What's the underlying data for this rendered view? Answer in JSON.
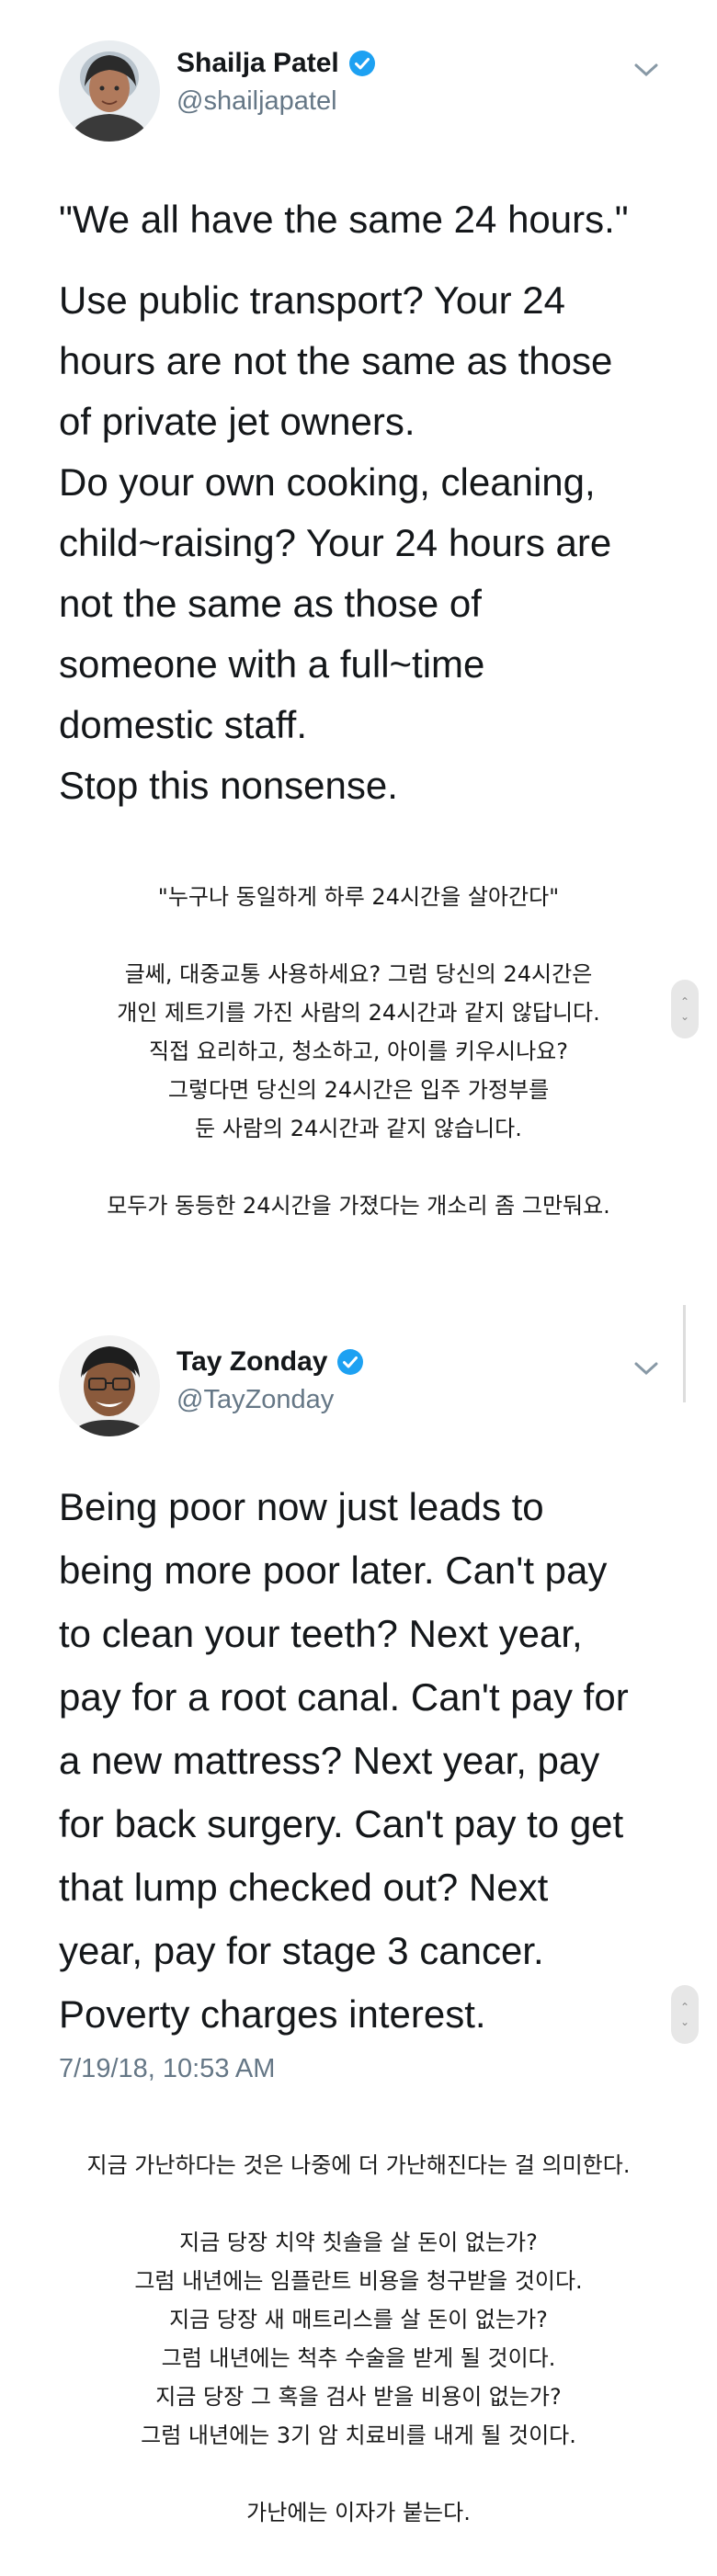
{
  "tweet1": {
    "user_name": "Shailja Patel",
    "handle": "@shailjapatel",
    "lines": [
      "\"We all have the same 24 hours.\"",
      "Use public transport? Your 24",
      "hours are not the same as those",
      "of private jet owners.",
      "Do your own cooking, cleaning,",
      "child~raising? Your 24 hours are",
      "not the same as those of",
      "someone with a full~time",
      "domestic staff.",
      "Stop this nonsense."
    ]
  },
  "translation1": {
    "lines": [
      "\"누구나 동일하게 하루 24시간을 살아간다\"",
      "",
      "글쎄, 대중교통 사용하세요? 그럼 당신의 24시간은",
      "개인 제트기를 가진 사람의 24시간과 같지 않답니다.",
      "직접 요리하고, 청소하고, 아이를 키우시나요?",
      "그렇다면 당신의 24시간은 입주 가정부를",
      "둔 사람의 24시간과 같지 않습니다.",
      "",
      "모두가 동등한 24시간을 가졌다는 개소리 좀 그만둬요."
    ]
  },
  "tweet2": {
    "user_name": "Tay Zonday",
    "handle": "@TayZonday",
    "lines": [
      "Being poor now just leads to",
      "being more poor later. Can't pay",
      "to clean your teeth? Next year,",
      "pay for a root canal. Can't pay for",
      "a new mattress? Next year, pay",
      "for back surgery. Can't pay to get",
      "that lump checked out? Next",
      "year, pay for stage 3 cancer.",
      "Poverty charges interest."
    ],
    "timestamp": "7/19/18, 10:53 AM"
  },
  "translation2": {
    "lines": [
      "지금 가난하다는 것은 나중에 더 가난해진다는 걸 의미한다.",
      "",
      "지금 당장 치약 칫솔을 살 돈이 없는가?",
      "그럼 내년에는 임플란트 비용을 청구받을 것이다.",
      "지금 당장 새 매트리스를 살 돈이 없는가?",
      "그럼 내년에는 척추 수술을 받게 될 것이다.",
      "지금 당장 그 혹을 검사 받을 비용이 없는가?",
      "그럼 내년에는 3기 암 치료비를 내게 될 것이다.",
      "",
      "가난에는 이자가 붙는다."
    ]
  },
  "icons": {
    "verified": "verified-badge-icon",
    "chevron": "chevron-down-icon",
    "scroll": "scroll-arrows-icon"
  },
  "colors": {
    "verified": "#1da1f2",
    "text": "#14171a",
    "secondary": "#657786"
  }
}
